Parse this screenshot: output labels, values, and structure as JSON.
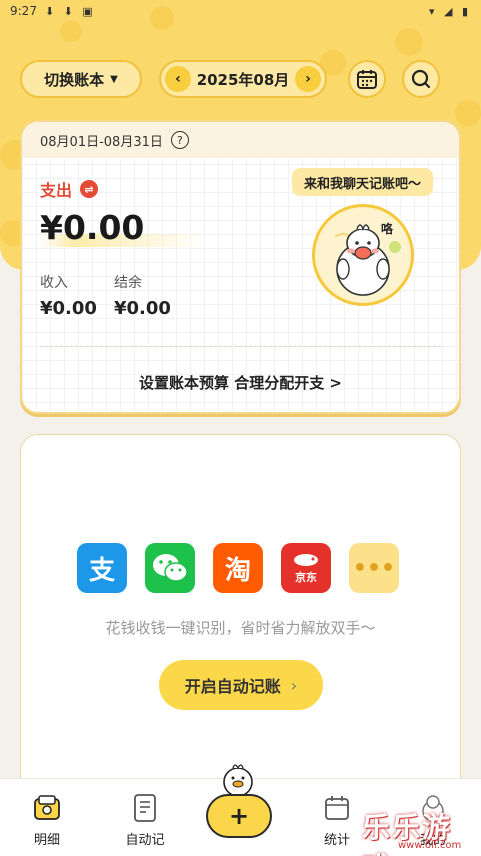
{
  "status_bar": {
    "time": "9:27",
    "left_icons": "⬇ ⬇ ▣",
    "right_icons": "▾ ◢ ▮"
  },
  "header": {
    "switch_book_label": "切换账本",
    "month_label": "2025年08月",
    "prev_arrow": "‹",
    "next_arrow": "›"
  },
  "summary": {
    "date_range": "08月01日-08月31日",
    "help_glyph": "?",
    "expense_label": "支出",
    "swap_glyph": "⇌",
    "expense_amount": "¥0.00",
    "income_label": "收入",
    "income_value": "¥0.00",
    "balance_label": "结余",
    "balance_value": "¥0.00",
    "chat_prompt": "来和我聊天记账吧～",
    "mascot_speech": "咯",
    "budget_link": "设置账本预算 合理分配开支 >"
  },
  "auto_record": {
    "apps": [
      {
        "name": "alipay-icon",
        "glyph": "支"
      },
      {
        "name": "wechat-icon",
        "glyph": ""
      },
      {
        "name": "taobao-icon",
        "glyph": "淘"
      },
      {
        "name": "jd-icon",
        "glyph": "京东"
      },
      {
        "name": "more-icon",
        "glyph": "•••"
      }
    ],
    "description": "花钱收钱一键识别，省时省力解放双手～",
    "button_label": "开启自动记账",
    "button_chevron": "›"
  },
  "tabbar": {
    "detail": "明细",
    "auto": "自动记",
    "add": "+",
    "stats": "统计",
    "mine": "我的"
  },
  "watermark": {
    "text": "乐乐游戏",
    "url": "www.6li.com"
  },
  "colors": {
    "accent": "#fbd86a",
    "expense": "#e54a37",
    "button": "#fbd74a"
  }
}
